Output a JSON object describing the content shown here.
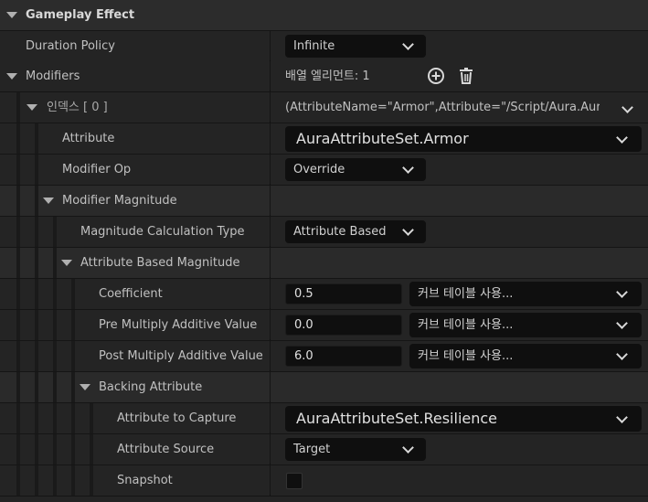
{
  "section": {
    "title": "Gameplay Effect"
  },
  "rows": {
    "duration_policy": {
      "label": "Duration Policy",
      "value": "Infinite"
    },
    "modifiers": {
      "label": "Modifiers",
      "count_text": "배열 엘리먼트: 1"
    },
    "index0": {
      "label": "인덱스 [ 0 ]",
      "value": "(AttributeName=\"Armor\",Attribute=\"/Script/Aura.AuraAttribu"
    },
    "attribute": {
      "label": "Attribute",
      "value": "AuraAttributeSet.Armor"
    },
    "modifier_op": {
      "label": "Modifier Op",
      "value": "Override"
    },
    "modifier_magnitude": {
      "label": "Modifier Magnitude"
    },
    "calc_type": {
      "label": "Magnitude Calculation Type",
      "value": "Attribute Based"
    },
    "attr_based_mag": {
      "label": "Attribute Based Magnitude"
    },
    "coefficient": {
      "label": "Coefficient",
      "value": "0.5",
      "curve": "커브 테이블 사용..."
    },
    "pre_mult": {
      "label": "Pre Multiply Additive Value",
      "value": "0.0",
      "curve": "커브 테이블 사용..."
    },
    "post_mult": {
      "label": "Post Multiply Additive Value",
      "value": "6.0",
      "curve": "커브 테이블 사용..."
    },
    "backing_attr": {
      "label": "Backing Attribute"
    },
    "attr_to_capture": {
      "label": "Attribute to Capture",
      "value": "AuraAttributeSet.Resilience"
    },
    "attr_source": {
      "label": "Attribute Source",
      "value": "Target"
    },
    "snapshot": {
      "label": "Snapshot",
      "checked": false
    }
  },
  "icons": {
    "add": "plus-circle-icon",
    "delete": "trash-icon",
    "expand": "triangle-down-icon",
    "dropdown": "chevron-down-icon"
  }
}
